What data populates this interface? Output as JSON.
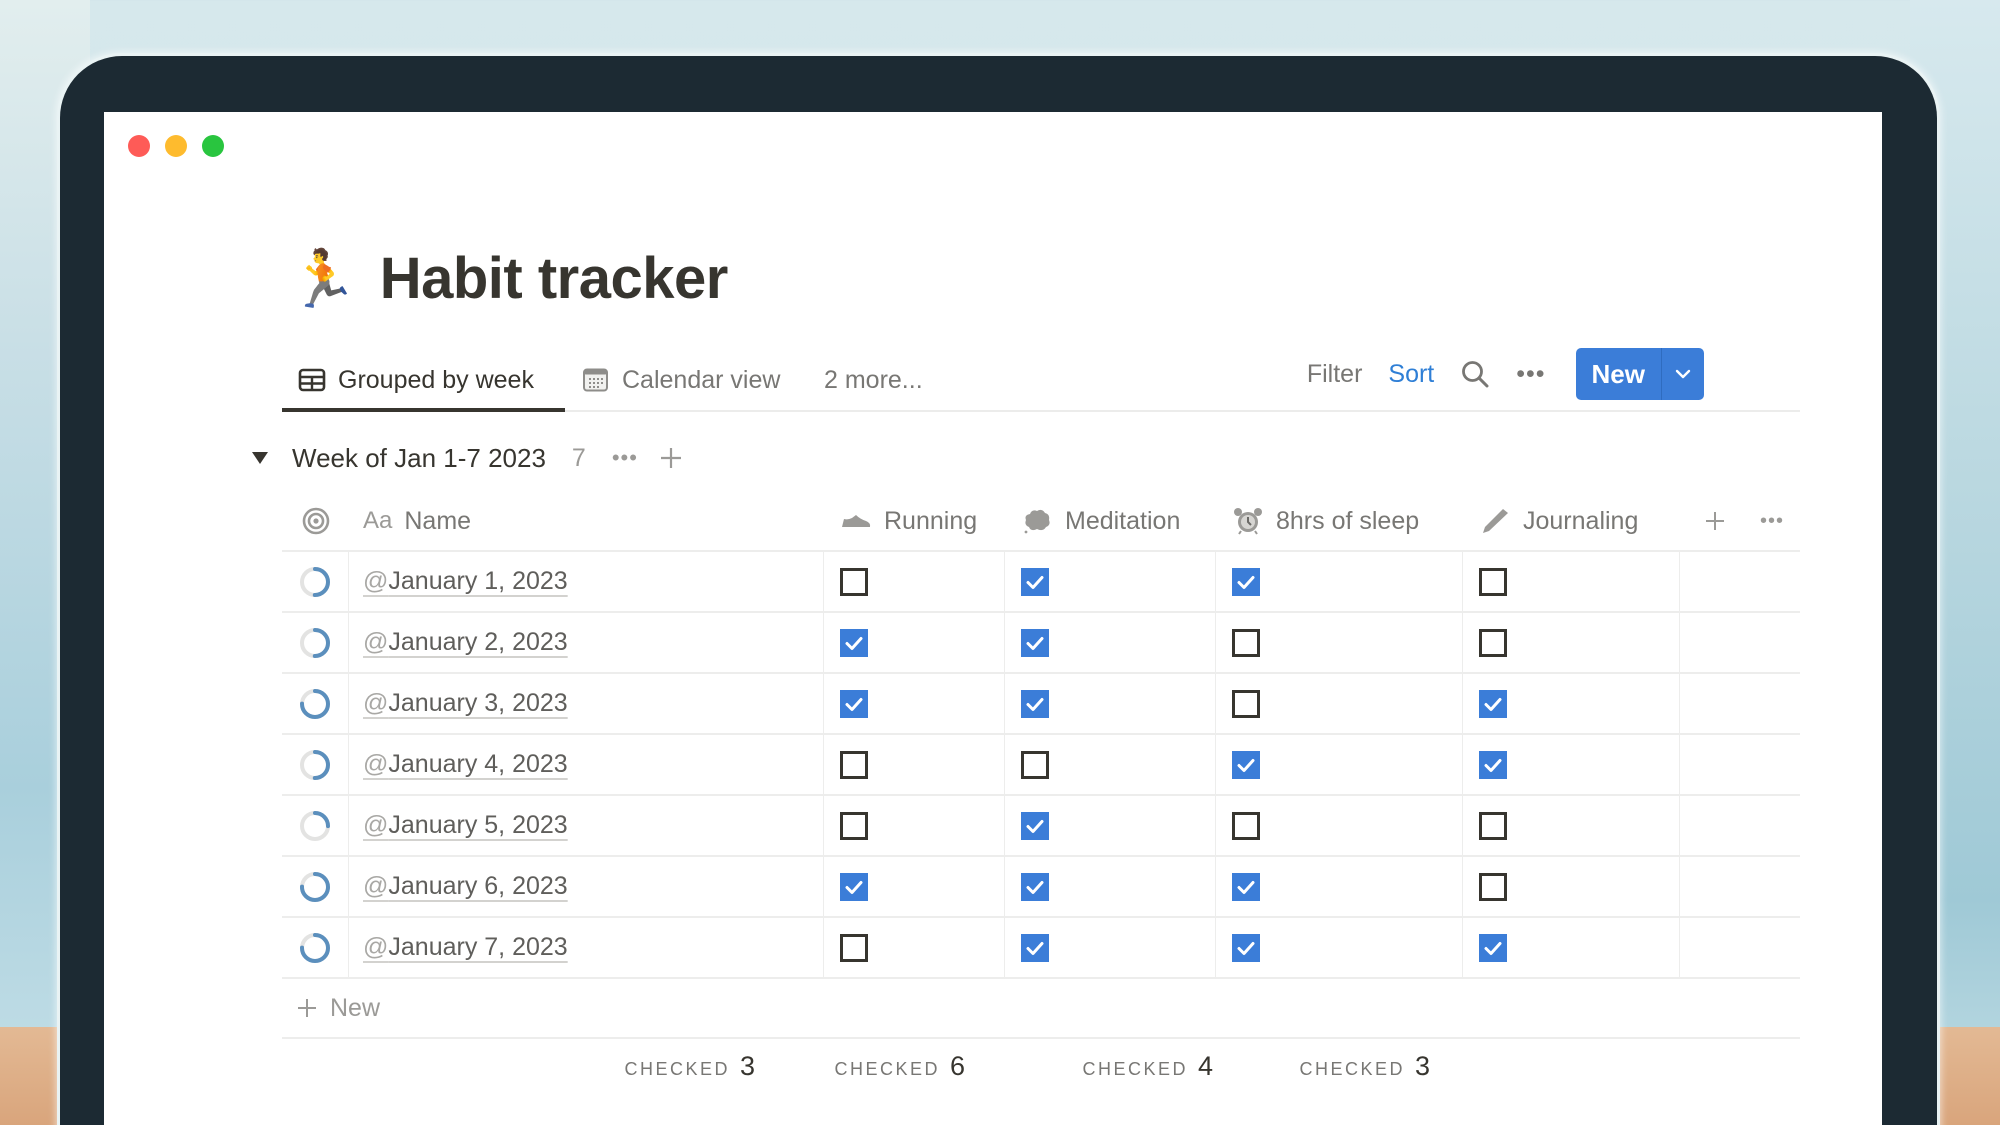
{
  "window": {
    "controls": [
      "close",
      "minimize",
      "maximize"
    ]
  },
  "page": {
    "icon": "🏃",
    "title": "Habit tracker"
  },
  "views": {
    "tabs": [
      {
        "label": "Grouped by week",
        "icon": "table-icon",
        "active": true
      },
      {
        "label": "Calendar view",
        "icon": "calendar-icon",
        "active": false
      }
    ],
    "more_label": "2 more..."
  },
  "toolbar": {
    "filter_label": "Filter",
    "sort_label": "Sort",
    "more_label": "•••",
    "new_label": "New",
    "accent_color": "#3b7dd8",
    "sort_color": "#2f7fd6"
  },
  "group": {
    "title": "Week of Jan 1-7 2023",
    "count": "7",
    "more_label": "•••"
  },
  "table": {
    "columns": {
      "name": {
        "prefix": "Aa",
        "label": "Name"
      },
      "running": {
        "label": "Running",
        "icon": "sneaker-icon"
      },
      "meditation": {
        "label": "Meditation",
        "icon": "thought-bubble-icon"
      },
      "sleep": {
        "label": "8hrs of sleep",
        "icon": "alarm-clock-icon"
      },
      "journaling": {
        "label": "Journaling",
        "icon": "pencil-icon"
      }
    },
    "rows": [
      {
        "at": "@",
        "name": "January 1, 2023",
        "progress": 0.5,
        "running": false,
        "meditation": true,
        "sleep": true,
        "journaling": false
      },
      {
        "at": "@",
        "name": "January 2, 2023",
        "progress": 0.5,
        "running": true,
        "meditation": true,
        "sleep": false,
        "journaling": false
      },
      {
        "at": "@",
        "name": "January 3, 2023",
        "progress": 0.75,
        "running": true,
        "meditation": true,
        "sleep": false,
        "journaling": true
      },
      {
        "at": "@",
        "name": "January 4, 2023",
        "progress": 0.5,
        "running": false,
        "meditation": false,
        "sleep": true,
        "journaling": true
      },
      {
        "at": "@",
        "name": "January 5, 2023",
        "progress": 0.25,
        "running": false,
        "meditation": true,
        "sleep": false,
        "journaling": false
      },
      {
        "at": "@",
        "name": "January 6, 2023",
        "progress": 0.75,
        "running": true,
        "meditation": true,
        "sleep": true,
        "journaling": false
      },
      {
        "at": "@",
        "name": "January 7, 2023",
        "progress": 0.75,
        "running": false,
        "meditation": true,
        "sleep": true,
        "journaling": true
      }
    ],
    "new_row_label": "New",
    "footer": {
      "running": {
        "label": "CHECKED",
        "value": "3"
      },
      "meditation": {
        "label": "CHECKED",
        "value": "6"
      },
      "sleep": {
        "label": "CHECKED",
        "value": "4"
      },
      "journaling": {
        "label": "CHECKED",
        "value": "3"
      }
    },
    "progress_color": "#5b8fbd",
    "progress_track_color": "#e3e3e2",
    "checkbox_color": "#3b7dd8"
  }
}
